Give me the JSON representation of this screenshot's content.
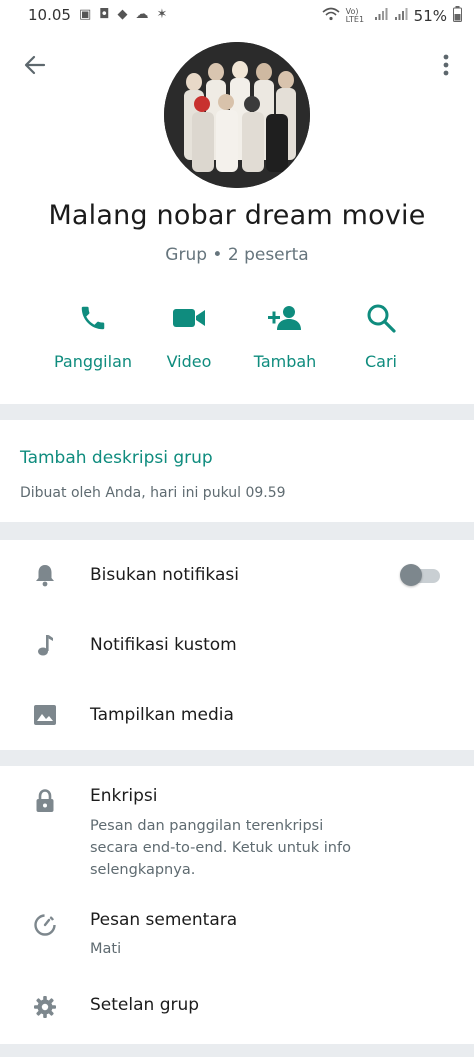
{
  "status_bar": {
    "time": "10.05",
    "network_label": "Vo) LTE1",
    "battery": "51%"
  },
  "header": {
    "back_icon": "arrow-left-icon",
    "menu_icon": "more-vertical-icon",
    "group_name": "Malang nobar dream movie",
    "group_subtitle": "Grup • 2 peserta"
  },
  "actions": [
    {
      "label": "Panggilan",
      "icon": "phone-icon"
    },
    {
      "label": "Video",
      "icon": "video-icon"
    },
    {
      "label": "Tambah",
      "icon": "add-person-icon"
    },
    {
      "label": "Cari",
      "icon": "search-icon"
    }
  ],
  "description": {
    "add_label": "Tambah deskripsi grup",
    "created_text": "Dibuat oleh Anda, hari ini pukul 09.59"
  },
  "notifications": {
    "mute_label": "Bisukan notifikasi",
    "mute_on": false,
    "custom_label": "Notifikasi kustom",
    "media_label": "Tampilkan media"
  },
  "security": {
    "encryption_title": "Enkripsi",
    "encryption_line1": "Pesan dan panggilan terenkripsi",
    "encryption_line2": "secara end-to-end. Ketuk untuk info",
    "encryption_line3": "selengkapnya.",
    "disappearing_title": "Pesan sementara",
    "disappearing_value": "Mati",
    "settings_title": "Setelan grup"
  },
  "colors": {
    "accent": "#0f8c7e",
    "icon_gray": "#7d878d",
    "background": "#e9ecef"
  }
}
